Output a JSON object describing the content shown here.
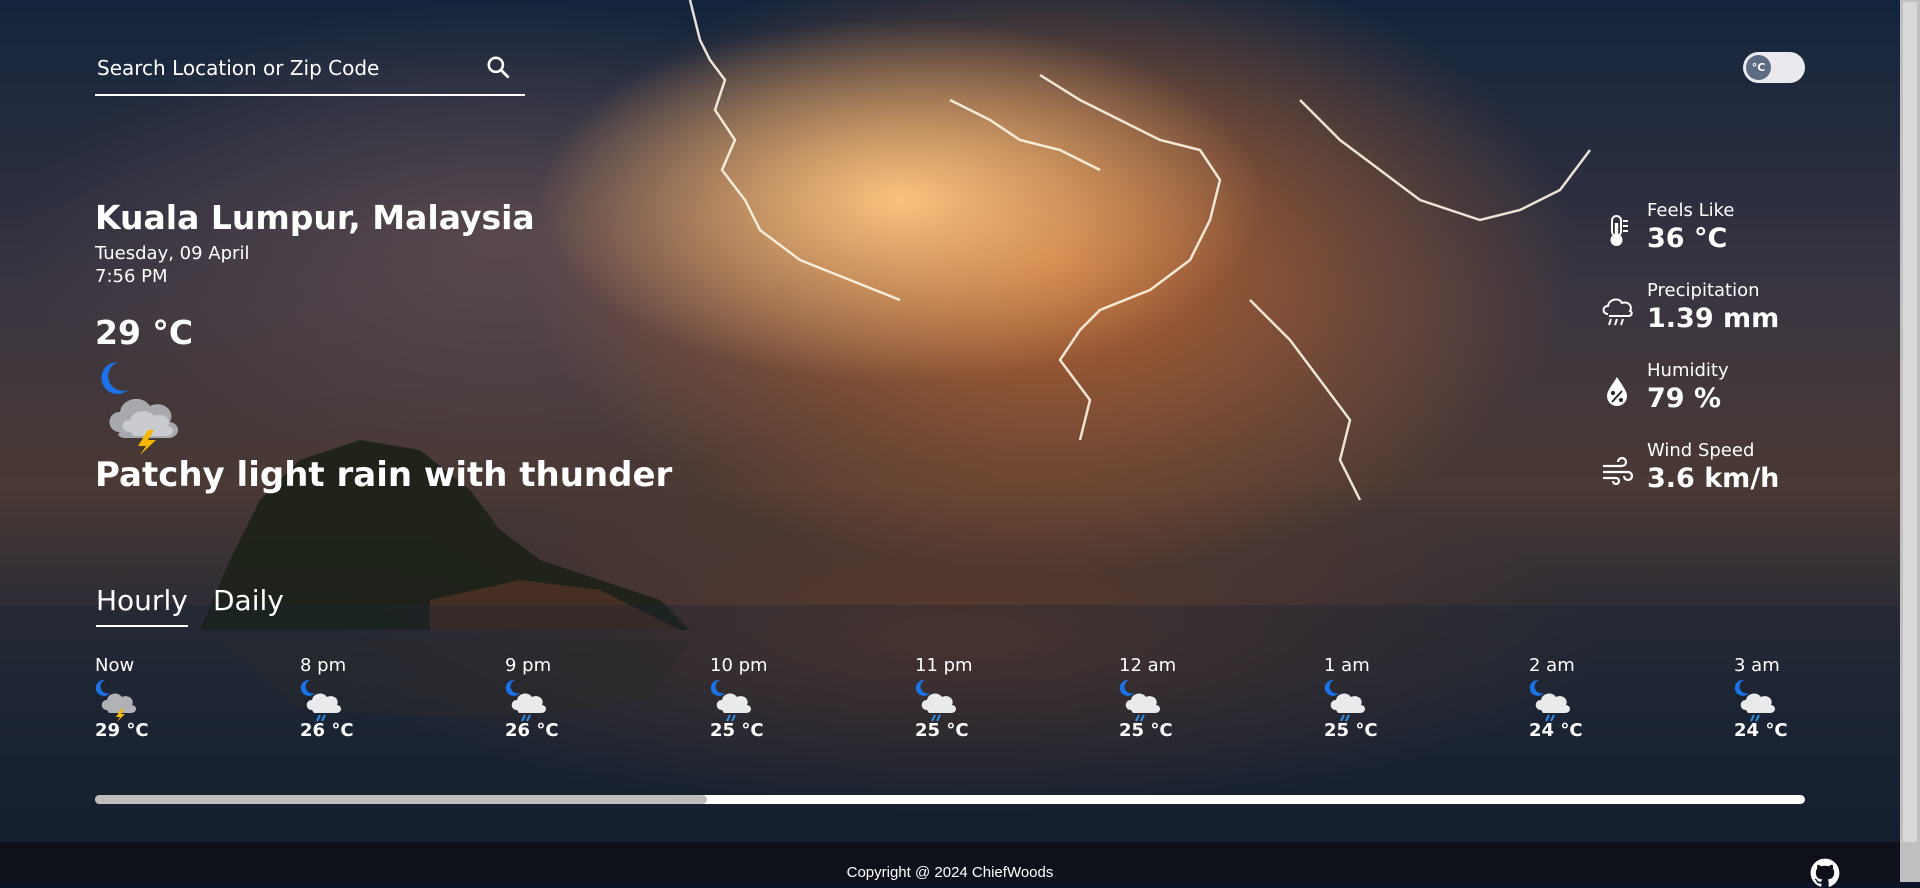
{
  "search": {
    "placeholder": "Search Location or Zip Code"
  },
  "unit_toggle": {
    "label": "°C"
  },
  "current": {
    "location": "Kuala Lumpur, Malaysia",
    "date": "Tuesday, 09 April",
    "time": "7:56 PM",
    "temperature": "29 °C",
    "condition": "Patchy light rain with thunder",
    "icon": "moon-cloud-thunder-icon"
  },
  "stats": [
    {
      "label": "Feels Like",
      "value": "36 °C",
      "icon": "thermometer-icon"
    },
    {
      "label": "Precipitation",
      "value": "1.39 mm",
      "icon": "rain-cloud-icon"
    },
    {
      "label": "Humidity",
      "value": "79 %",
      "icon": "droplet-icon"
    },
    {
      "label": "Wind Speed",
      "value": "3.6 km/h",
      "icon": "wind-icon"
    }
  ],
  "tabs": [
    {
      "label": "Hourly",
      "active": true
    },
    {
      "label": "Daily",
      "active": false
    }
  ],
  "hourly": [
    {
      "time": "Now",
      "temp": "29 °C",
      "icon": "moon-cloud-thunder-icon"
    },
    {
      "time": "8 pm",
      "temp": "26 °C",
      "icon": "moon-cloud-rain-icon"
    },
    {
      "time": "9 pm",
      "temp": "26 °C",
      "icon": "moon-cloud-rain-icon"
    },
    {
      "time": "10 pm",
      "temp": "25 °C",
      "icon": "moon-cloud-rain-icon"
    },
    {
      "time": "11 pm",
      "temp": "25 °C",
      "icon": "moon-cloud-rain-icon"
    },
    {
      "time": "12 am",
      "temp": "25 °C",
      "icon": "moon-cloud-rain-icon"
    },
    {
      "time": "1 am",
      "temp": "25 °C",
      "icon": "moon-cloud-rain-icon"
    },
    {
      "time": "2 am",
      "temp": "24 °C",
      "icon": "moon-cloud-rain-icon"
    },
    {
      "time": "3 am",
      "temp": "24 °C",
      "icon": "moon-cloud-rain-icon"
    }
  ],
  "hourly_scroll_position": 0.36,
  "footer": {
    "copyright": "Copyright @ 2024 ChiefWoods",
    "github_icon": "github-icon"
  }
}
